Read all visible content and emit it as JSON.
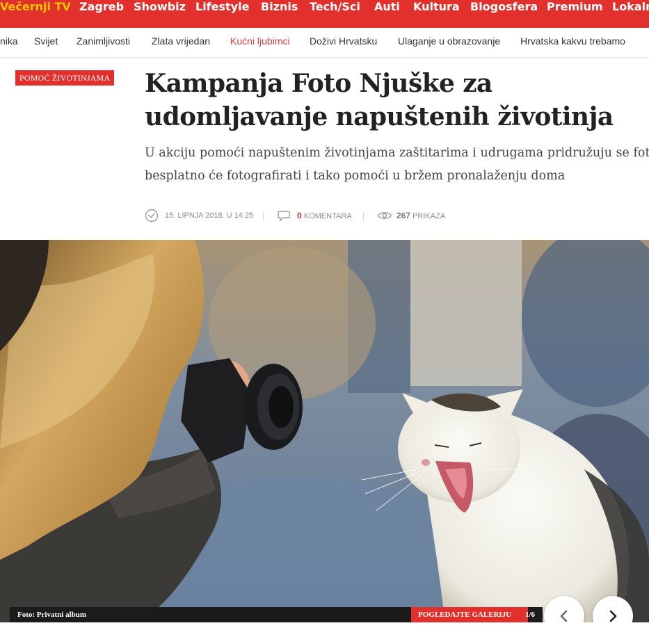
{
  "topnav": {
    "items": [
      "Večernji TV",
      "Zagreb",
      "Showbiz",
      "Lifestyle",
      "Biznis",
      "Tech/Sci",
      "Auti",
      "Kultura",
      "Blogosfera",
      "Premium",
      "Lokalni"
    ]
  },
  "subnav": {
    "items": [
      "nika",
      "Svijet",
      "Zanimljivosti",
      "Zlata vrijedan",
      "Kućni ljubimci",
      "Doživi Hrvatsku",
      "Ulaganje u obrazovanje",
      "Hrvatska kakvu trebamo"
    ],
    "active_index": 4
  },
  "article": {
    "category": "POMOĆ ŽIVOTINJAMA",
    "headline_line1": "Kampanja Foto Njuške za",
    "headline_line2": "udomljavanje napuštenih životinja",
    "lead_line1": "U akciju pomoći napuštenim životinjama zaštitarima i udrugama pridružuju se fotog",
    "lead_line2": "besplatno će fotografirati i tako pomoći u bržem pronalaženju doma",
    "date": "15. LIPNJA 2018. U 14:25",
    "comments_count": "0",
    "comments_label": "KOMENTARA",
    "views_count": "267",
    "views_label": "PRIKAZA",
    "date_icon": "clock-icon",
    "comments_icon": "comment-icon",
    "views_icon": "eye-icon"
  },
  "gallery": {
    "caption": "Foto: Privatni album",
    "link_label": "POGLEDAJTE GALERIJU",
    "counter": "1/6",
    "prev_icon": "chevron-left-icon",
    "next_icon": "chevron-right-icon"
  },
  "colors": {
    "brand_red": "#e2312c",
    "tv_yellow": "#f8c400",
    "active_link": "#d93a3a"
  }
}
